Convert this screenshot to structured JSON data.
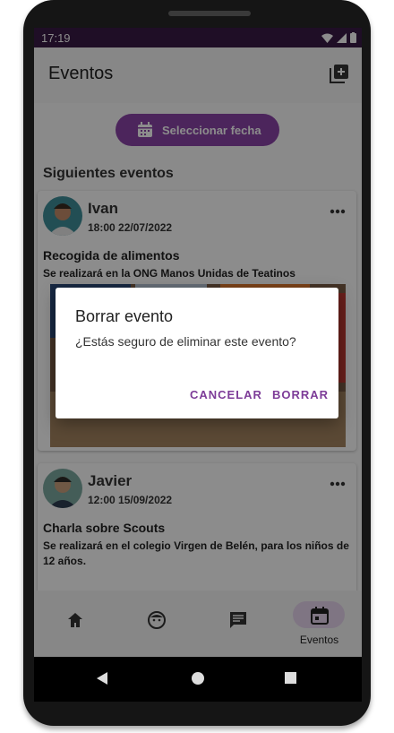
{
  "status_bar": {
    "time": "17:19"
  },
  "app_bar": {
    "title": "Eventos"
  },
  "date_button": {
    "label": "Seleccionar fecha"
  },
  "section_title": "Siguientes eventos",
  "events": [
    {
      "author": "Ivan",
      "datetime": "18:00 22/07/2022",
      "title": "Recogida de alimentos",
      "description": "Se realizará en la ONG Manos Unidas de Teatinos"
    },
    {
      "author": "Javier",
      "datetime": "12:00 15/09/2022",
      "title": "Charla sobre Scouts",
      "description": "Se realizará en el colegio Virgen de Belén, para los niños de 12 años."
    }
  ],
  "bottom_nav": {
    "items": [
      {
        "icon": "home-icon"
      },
      {
        "icon": "face-icon"
      },
      {
        "icon": "chat-icon"
      },
      {
        "icon": "calendar-icon",
        "label": "Eventos",
        "active": true
      }
    ]
  },
  "dialog": {
    "title": "Borrar evento",
    "message": "¿Estás seguro de eliminar este evento?",
    "cancel_label": "CANCELAR",
    "confirm_label": "BORRAR"
  },
  "colors": {
    "accent": "#8b44a8",
    "status_bar": "#3a1b46",
    "dialog_button": "#7d3c98"
  }
}
